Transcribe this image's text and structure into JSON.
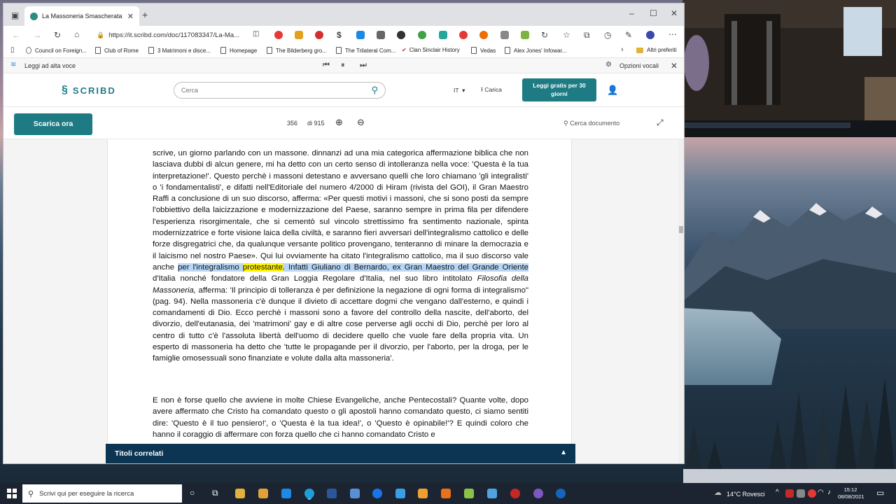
{
  "browser": {
    "tab_title": "La Massoneria Smascherata",
    "url": "https://it.scribd.com/doc/117083347/La-Ma...",
    "bookmarks": [
      "Council on Foreign...",
      "Club of Rome",
      "3 Matrimoni e disce...",
      "Homepage",
      "The Bilderberg gro...",
      "The Trilateral Com...",
      "Clan Sinclair History",
      "Vedas",
      "Alex Jones' Infowar..."
    ],
    "other_bookmarks": "Altri preferiti",
    "read_aloud_label": "Leggi ad alta voce",
    "voice_options_label": "Opzioni vocali"
  },
  "scribd": {
    "logo_text": "SCRIBD",
    "search_placeholder": "Cerca",
    "language": "IT",
    "upload_label": "Carica",
    "read_free_line1": "Leggi gratis per 30",
    "read_free_line2": "giorni"
  },
  "toolbar": {
    "download_label": "Scarica ora",
    "current_page": "356",
    "total_pages_label": "di 915",
    "search_doc_label": "Cerca documento"
  },
  "document": {
    "para1_a": "scrive, un giorno parlando con un massone. dinnanzi ad una mia categorica affermazione biblica che non lasciava dubbi di alcun genere, mi ha detto con un certo senso di intolleranza nella voce: 'Questa è la tua interpretazione!'. Questo perchè i massoni detestano e avversano quelli che loro chiamano 'gli integralisti' o 'i fondamentalisti', e difatti nell'Editoriale del numero 4/2000 di Hiram (rivista del GOI), il Gran Maestro Raffi a conclusione di un suo discorso, afferma: «Per questi motivi i massoni, che si sono posti da sempre l'obbiettivo della laicizzazione e modernizzazione del Paese, saranno sempre in prima fila per difendere l'esperienza risorgimentale, che si cementò sul vincolo strettissimo fra sentimento nazionale, spinta modernizzatrice e forte visione laica della civiltà, e saranno fieri avversari dell'integralismo cattolico e delle forze disgregatrici che, da qualunque versante politico provengano, tenteranno di minare la democrazia e il laicismo nel nostro Paese». Qui lui ovviamente ha citato l'integralismo cattolico, ma il suo discorso vale anche ",
    "para1_hl1": "per l'integralismo ",
    "para1_hl_word": "protestante",
    "para1_hl2": ". Infatti Giuliano di Bernardo, ex Gran Maestro del Grande Oriente",
    "para1_b": " d'Italia nonché fondatore della Gran Loggia Regolare d'Italia, nel suo libro intitolato ",
    "para1_book": "Filosofia della Massoneria,",
    "para1_c": " afferma: 'Il principio di tolleranza è per definizione la negazione di ogni forma di integralismo\" (pag. 94). Nella massoneria c'è dunque il divieto di accettare dogmi che vengano dall'esterno, e quindi i comandamenti di Dio. Ecco perchè i massoni sono a favore del controllo della nascite, dell'aborto, del divorzio, dell'eutanasia, dei 'matrimoni' gay e di altre cose perverse agli occhi di Dio, perchè per loro al centro di tutto c'è l'assoluta libertà dell'uomo di decidere quello che vuole fare della propria vita. Un esperto di massoneria ha detto che 'tutte le propagande per il divorzio, per l'aborto, per la droga, per le famiglie omosessuali sono finanziate e volute dalla alta massoneria'.",
    "para2": "E non è forse quello che avviene in molte Chiese Evangeliche, anche Pentecostali? Quante volte, dopo avere affermato che Cristo ha comandato questo o gli apostoli hanno comandato questo, ci siamo sentiti dire: 'Questo è il tuo pensiero!', o 'Questa è la tua idea!', o 'Questo è opinabile!'? E quindi coloro che hanno il coraggio di affermare con forza quello che ci hanno comandato Cristo e"
  },
  "related": {
    "label": "Titoli correlati"
  },
  "taskbar": {
    "search_placeholder": "Scrivi qui per eseguire la ricerca",
    "weather": "14°C Rovesci",
    "time": "15:12",
    "date": "08/08/2021"
  },
  "colors": {
    "scribd_teal": "#1e7b84",
    "related_bar": "#0b3553",
    "highlight_blue": "#b9d7f5",
    "highlight_yellow": "#fff200"
  }
}
